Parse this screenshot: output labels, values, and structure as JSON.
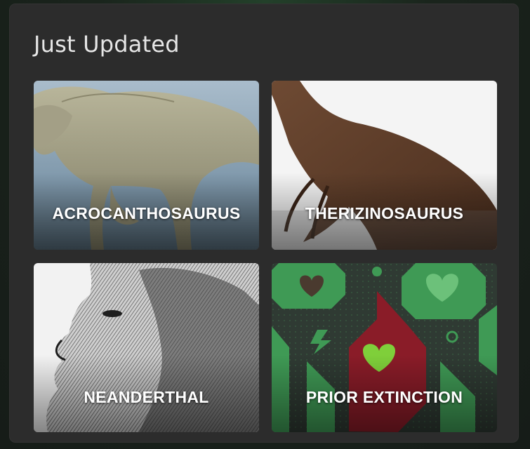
{
  "section": {
    "title": "Just Updated"
  },
  "cards": [
    {
      "label": "ACROCANTHOSAURUS",
      "image": "acrocanthosaurus-illustration"
    },
    {
      "label": "THERIZINOSAURUS",
      "image": "therizinosaurus-illustration"
    },
    {
      "label": "NEANDERTHAL",
      "image": "neanderthal-engraving"
    },
    {
      "label": "PRIOR EXTINCTION",
      "image": "green-hearts-pattern"
    }
  ],
  "colors": {
    "panel_background": "#2c2c2c",
    "title_text": "#e6e6e6",
    "card_label_text": "#ffffff",
    "pattern_green": "#3f9a55",
    "pattern_red": "#8a1c28"
  }
}
